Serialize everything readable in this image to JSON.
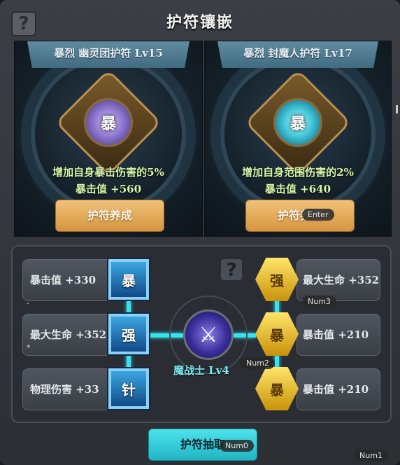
{
  "window": {
    "title": "护符镶嵌",
    "help_glyph": "?"
  },
  "cards": [
    {
      "banner": "暴烈 幽灵团护符 Lv15",
      "glyph": "暴",
      "effect": "增加自身暴击伤害的5%",
      "crit": "暴击值 +560",
      "button": "护符养成"
    },
    {
      "banner": "暴烈 封魔人护符 Lv17",
      "glyph": "暴",
      "effect": "增加自身范围伤害的2%",
      "crit": "暴击值 +640",
      "button": "护符养成"
    }
  ],
  "left_slots": [
    {
      "stat": "暴击值 +330",
      "glyph": "暴"
    },
    {
      "stat": "最大生命 +352",
      "glyph": "强"
    },
    {
      "stat": "物理伤害 +33",
      "glyph": "针"
    }
  ],
  "right_slots": [
    {
      "stat": "最大生命 +352",
      "glyph": "强"
    },
    {
      "stat": "暴击值 +210",
      "glyph": "暴"
    },
    {
      "stat": "暴击值 +210",
      "glyph": "暴"
    }
  ],
  "hero": {
    "label": "魔战士 Lv4"
  },
  "draw_button": "护符抽取",
  "hotkeys": {
    "enter": "Enter",
    "num3": "Num3",
    "num2": "Num2",
    "num0": "Num0",
    "num1": "Num1",
    "dash": "-",
    "star": "*"
  },
  "colors": {
    "gold_button": "#e0a650",
    "cyan_button": "#34d4e0",
    "link_line": "#34e2f0",
    "effect_text": "#d7f6a8"
  }
}
